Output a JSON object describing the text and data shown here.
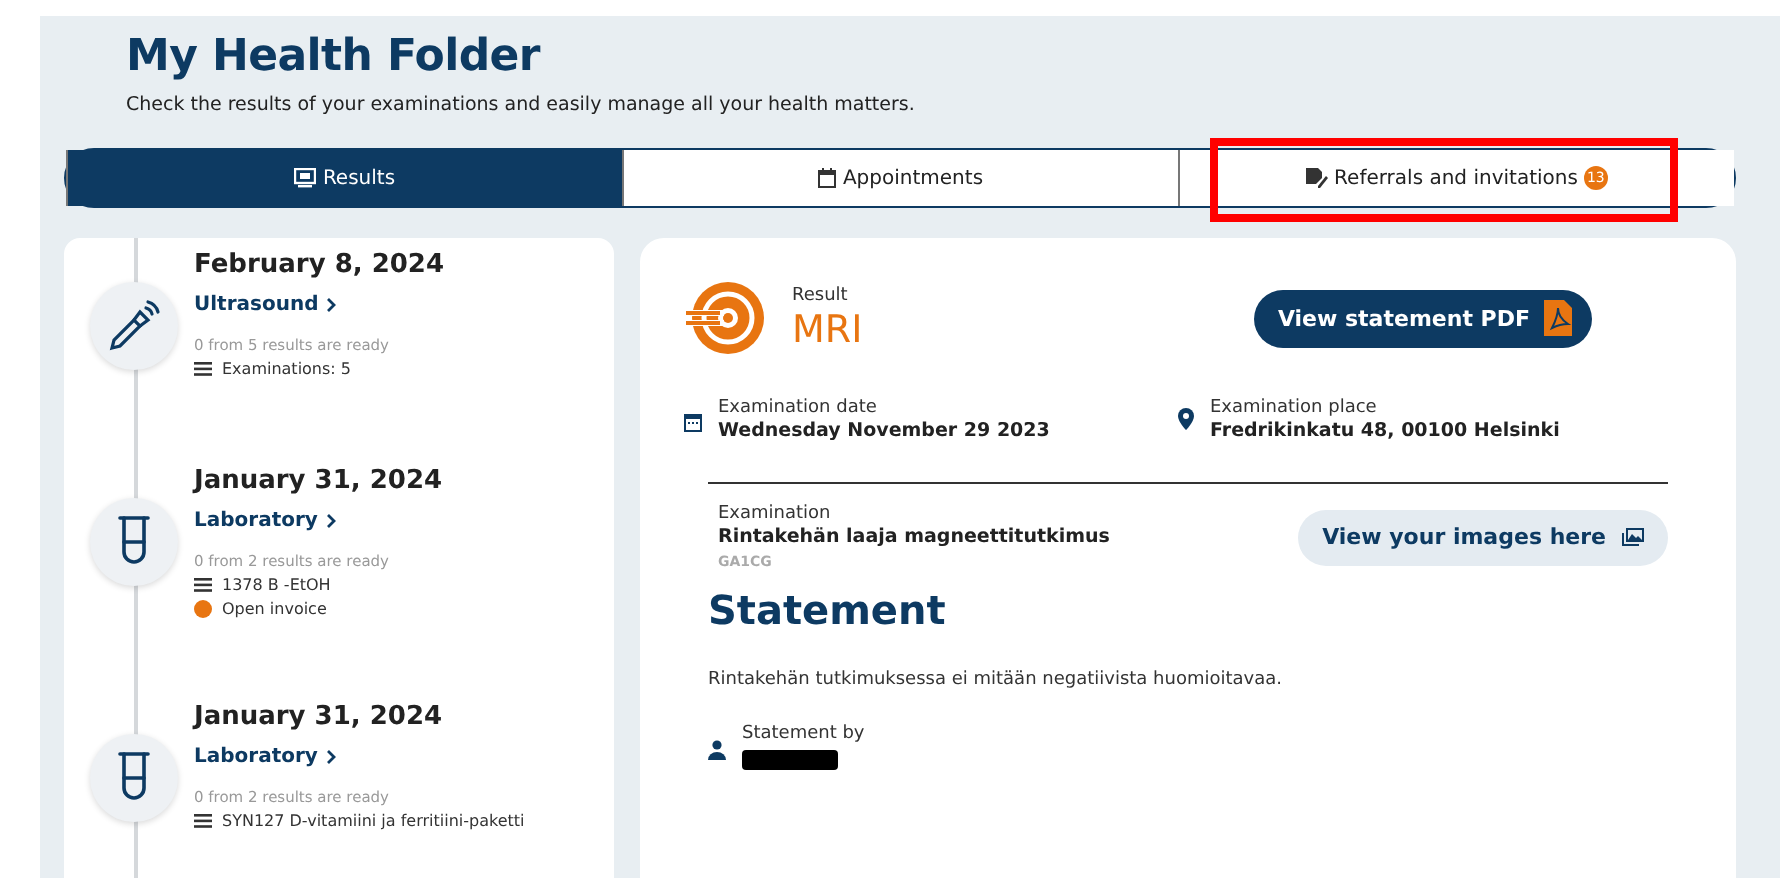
{
  "header": {
    "title": "My Health Folder",
    "subtitle": "Check the results of your examinations and easily manage all your health matters."
  },
  "tabs": [
    {
      "label": "Results",
      "kind": "monitor",
      "selected": true
    },
    {
      "label": "Appointments",
      "kind": "calendar",
      "selected": false
    },
    {
      "label": "Referrals and invitations",
      "kind": "referral",
      "selected": false,
      "badge": "13",
      "highlighted": true
    }
  ],
  "timeline": [
    {
      "date": "February 8, 2024",
      "kind": "ultrasound",
      "category": "Ultrasound",
      "status": "0 from 5 results are ready",
      "detail": "Examinations: 5"
    },
    {
      "date": "January 31, 2024",
      "kind": "laboratory",
      "category": "Laboratory",
      "status": "0 from 2 results are ready",
      "detail": "1378 B -EtOH",
      "invoice": "Open invoice"
    },
    {
      "date": "January 31, 2024",
      "kind": "laboratory",
      "category": "Laboratory",
      "status": "0 from 2 results are ready",
      "detail": "SYN127 D-vitamiini ja ferritiini-paketti"
    }
  ],
  "detail": {
    "result_label": "Result",
    "result": "MRI",
    "pdf_button": "View statement PDF",
    "date_label": "Examination date",
    "date": "Wednesday November 29 2023",
    "place_label": "Examination place",
    "place": "Fredrikinkatu 48, 00100 Helsinki",
    "exam_label": "Examination",
    "exam": "Rintakehän laaja magneettitutkimus",
    "exam_code": "GA1CG",
    "images_button": "View your images here",
    "statement_title": "Statement",
    "statement": "Rintakehän tutkimuksessa ei mitään negatiivista huomioitavaa.",
    "statement_by_label": "Statement by",
    "statement_by_redacted": true
  }
}
